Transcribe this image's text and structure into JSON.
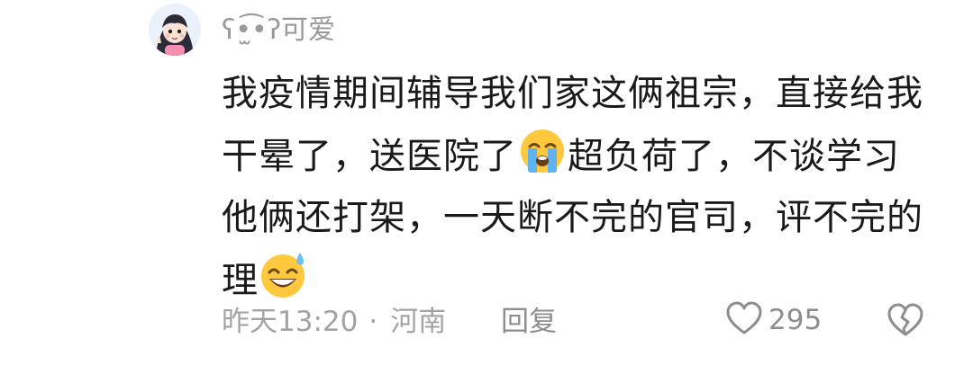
{
  "comment": {
    "username": "ʕ•̫͡•ʔ可爱",
    "lines": [
      {
        "text": "我疫情期间辅导我们家这俩祖宗，直接给我"
      },
      {
        "text_before": "干晕了，送医院了",
        "emoji": "loudly-crying-face-icon",
        "text_after": "超负荷了，不谈学习"
      },
      {
        "text": "他俩还打架，一天断不完的官司，评不完的"
      },
      {
        "text_before": "理",
        "emoji": "grinning-face-with-sweat-icon"
      }
    ],
    "time": "昨天13:20",
    "separator": "·",
    "location": "河南",
    "reply_label": "回复",
    "like_count": "295"
  },
  "colors": {
    "text": "#1a1a1a",
    "meta": "#a3a3a3",
    "icon": "#8e8e8e",
    "emoji_yellow": "#ffc83d"
  }
}
